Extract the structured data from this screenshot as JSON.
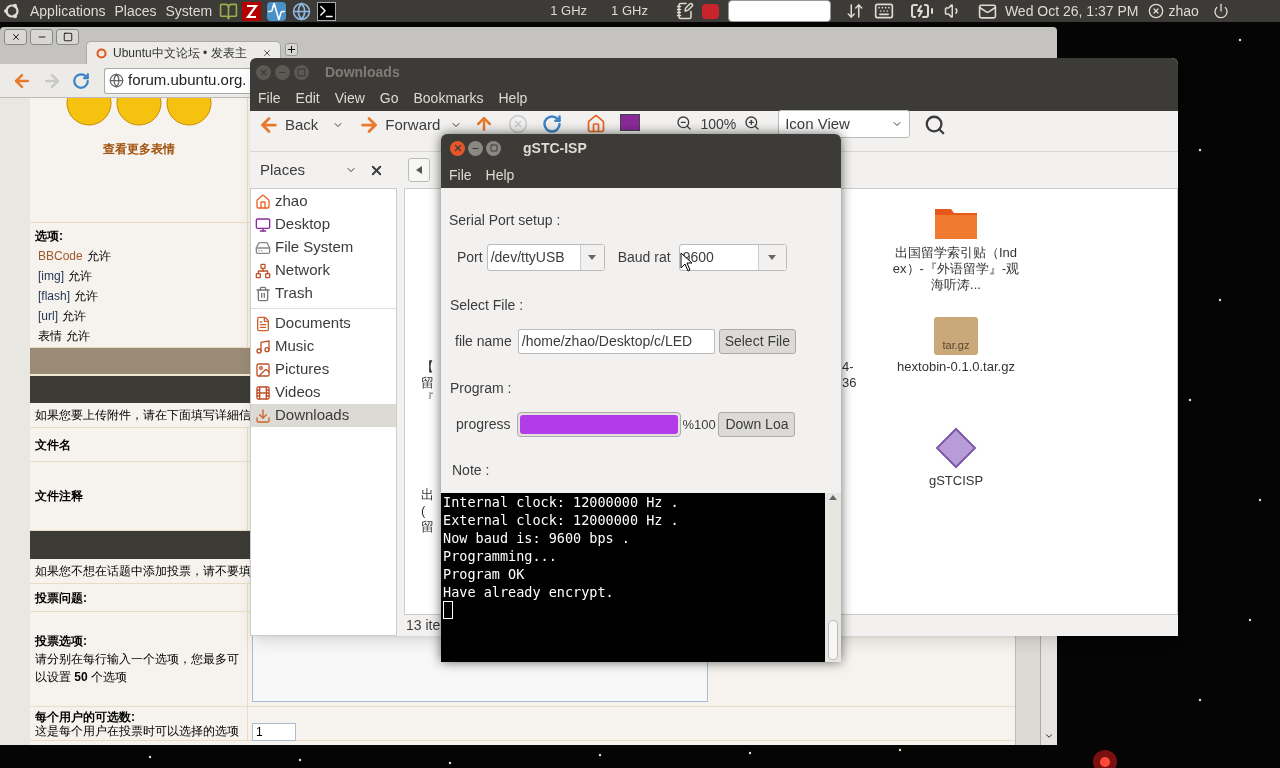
{
  "top_panel": {
    "menus": [
      "Applications",
      "Places",
      "System"
    ],
    "cpu": [
      "1 GHz",
      "1 GHz"
    ],
    "clock": "Wed Oct 26,  1:37 PM",
    "user": "zhao"
  },
  "browser": {
    "tab_title": "Ubuntu中文论坛 • 发表主",
    "url": "forum.ubuntu.org.",
    "page": {
      "emoticon_link": "查看更多表情",
      "options_title": "选项:",
      "options": [
        {
          "kind": "link",
          "tag": "BBCode",
          "value": "允许"
        },
        {
          "kind": "code",
          "tag": "[img]",
          "value": "允许"
        },
        {
          "kind": "code",
          "tag": "[flash]",
          "value": "允许"
        },
        {
          "kind": "code",
          "tag": "[url]",
          "value": "允许"
        },
        {
          "kind": "plain",
          "tag": "表情",
          "value": "允许"
        }
      ],
      "upload_hint": "如果您要上传附件，请在下面填写详細信",
      "file_name_label": "文件名",
      "file_comment_label": "文件注释",
      "poll_hint": "如果您不想在话题中添加投票，请不要填",
      "poll_question_label": "投票问题:",
      "poll_options_label": "投票选项:",
      "poll_options_desc": "请分别在每行输入一个选项，您最多可以设置 **50** 个选项",
      "per_user_label": "每个用户的可选数:",
      "per_user_desc": "这是每个用户在投票时可以选择的选项",
      "per_user_value": "1"
    }
  },
  "file_manager": {
    "title": "Downloads",
    "menus": [
      "File",
      "Edit",
      "View",
      "Go",
      "Bookmarks",
      "Help"
    ],
    "toolbar": {
      "back": "Back",
      "forward": "Forward",
      "zoom": "100%",
      "view": "Icon View"
    },
    "places_label": "Places",
    "sidebar": [
      [
        {
          "kind": "home",
          "label": "zhao",
          "selected": false
        },
        {
          "kind": "desktop",
          "label": "Desktop",
          "selected": false
        },
        {
          "kind": "drive",
          "label": "File System",
          "selected": false
        },
        {
          "kind": "network",
          "label": "Network",
          "selected": false
        },
        {
          "kind": "trash",
          "label": "Trash",
          "selected": false
        }
      ],
      [
        {
          "kind": "documents",
          "label": "Documents",
          "selected": false
        },
        {
          "kind": "music",
          "label": "Music",
          "selected": false
        },
        {
          "kind": "pictures",
          "label": "Pictures",
          "selected": false
        },
        {
          "kind": "videos",
          "label": "Videos",
          "selected": false
        },
        {
          "kind": "downloads",
          "label": "Downloads",
          "selected": true
        }
      ]
    ],
    "fragments_left": [
      [
        "【",
        "留",
        "『"
      ],
      [
        "出",
        "(",
        "留"
      ]
    ],
    "fragments_middle": [
      "4-",
      "36"
    ],
    "files": [
      {
        "kind": "folder",
        "label": "出国留学索引贴（Index）-『外语留学』-观海听涛..."
      },
      {
        "kind": "archive",
        "label": "hextobin-0.1.0.tar.gz",
        "badge": "tar.gz"
      },
      {
        "kind": "app",
        "label": "gSTCISP"
      }
    ],
    "status": "13 ite"
  },
  "gstc": {
    "title": "gSTC-ISP",
    "menus": [
      "File",
      "Help"
    ],
    "serial_label": "Serial Port setup :",
    "port_label": "Port",
    "port_value": "/dev/ttyUSB",
    "baud_label": "Baud rat",
    "baud_value": "9600",
    "select_label": "Select File :",
    "file_name_label": "file name",
    "file_path": "/home/zhao/Desktop/c/LED",
    "select_button": "Select File",
    "program_label": "Program :",
    "progress_label": "progress",
    "level": 1,
    "percent": "%100",
    "download_button": "Down Loa",
    "note_label": "Note :",
    "log": [
      "Internal clock: 12000000 Hz .",
      "External clock: 12000000 Hz .",
      "Now baud is: 9600 bps .",
      "Programming...",
      "Program OK",
      "Have already encrypt."
    ]
  }
}
